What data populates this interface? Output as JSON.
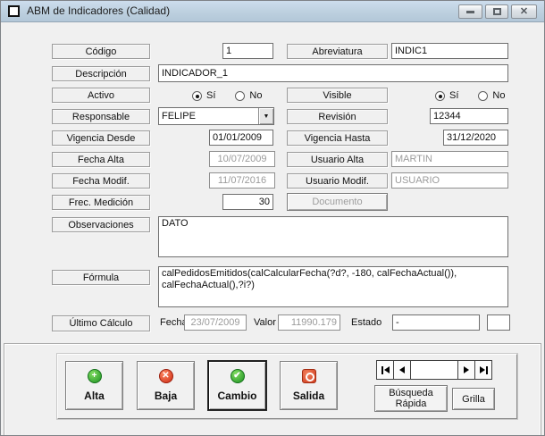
{
  "window": {
    "title": "ABM de Indicadores (Calidad)"
  },
  "icons": {
    "close": "✕",
    "combo_arrow": "▼",
    "plus": "+",
    "cross": "✕",
    "check": "✔",
    "navigator": [
      "first-record",
      "previous-record",
      "next-record",
      "last-record"
    ]
  },
  "fields": {
    "codigo": {
      "label": "Código",
      "value": "1"
    },
    "abreviatura": {
      "label": "Abreviatura",
      "value": "INDIC1"
    },
    "descripcion": {
      "label": "Descripción",
      "value": "INDICADOR_1"
    },
    "activo": {
      "label": "Activo",
      "yes": "Sí",
      "no": "No",
      "selected": "Sí"
    },
    "visible": {
      "label": "Visible",
      "yes": "Sí",
      "no": "No",
      "selected": "Sí"
    },
    "responsable": {
      "label": "Responsable",
      "value": "FELIPE"
    },
    "revision": {
      "label": "Revisión",
      "value": "12344"
    },
    "vigencia_desde": {
      "label": "Vigencia Desde",
      "value": "01/01/2009"
    },
    "vigencia_hasta": {
      "label": "Vigencia Hasta",
      "value": "31/12/2020"
    },
    "fecha_alta": {
      "label": "Fecha Alta",
      "value": "10/07/2009"
    },
    "usuario_alta": {
      "label": "Usuario Alta",
      "value": "MARTIN"
    },
    "fecha_modif": {
      "label": "Fecha Modif.",
      "value": "11/07/2016"
    },
    "usuario_modif": {
      "label": "Usuario Modif.",
      "value": "USUARIO"
    },
    "frec_medicion": {
      "label": "Frec. Medición",
      "value": "30"
    },
    "documento_button": {
      "label": "Documento"
    },
    "observaciones": {
      "label": "Observaciones",
      "value": "DATO"
    },
    "formula": {
      "label": "Fórmula",
      "value": "calPedidosEmitidos(calCalcularFecha(?d?, -180, calFechaActual()),\ncalFechaActual(),?i?)"
    },
    "ultimo_calculo": {
      "label": "Último Cálculo",
      "fecha_label": "Fecha",
      "fecha_value": "23/07/2009",
      "valor_label": "Valor",
      "valor_value": "11990.179",
      "estado_label": "Estado",
      "estado_value": "-"
    }
  },
  "actions": {
    "alta": {
      "label": "Alta"
    },
    "baja": {
      "label": "Baja"
    },
    "cambio": {
      "label": "Cambio"
    },
    "salida": {
      "label": "Salida"
    },
    "busqueda_rapida": {
      "label": "Búsqueda Rápida"
    },
    "grilla": {
      "label": "Grilla"
    }
  },
  "colors": {
    "titlebar": "#bdd0df",
    "window_bg": "#f0f0f0",
    "action_green": "#1d9222",
    "action_red": "#cc2a12",
    "salida_orange": "#d03c1e"
  }
}
